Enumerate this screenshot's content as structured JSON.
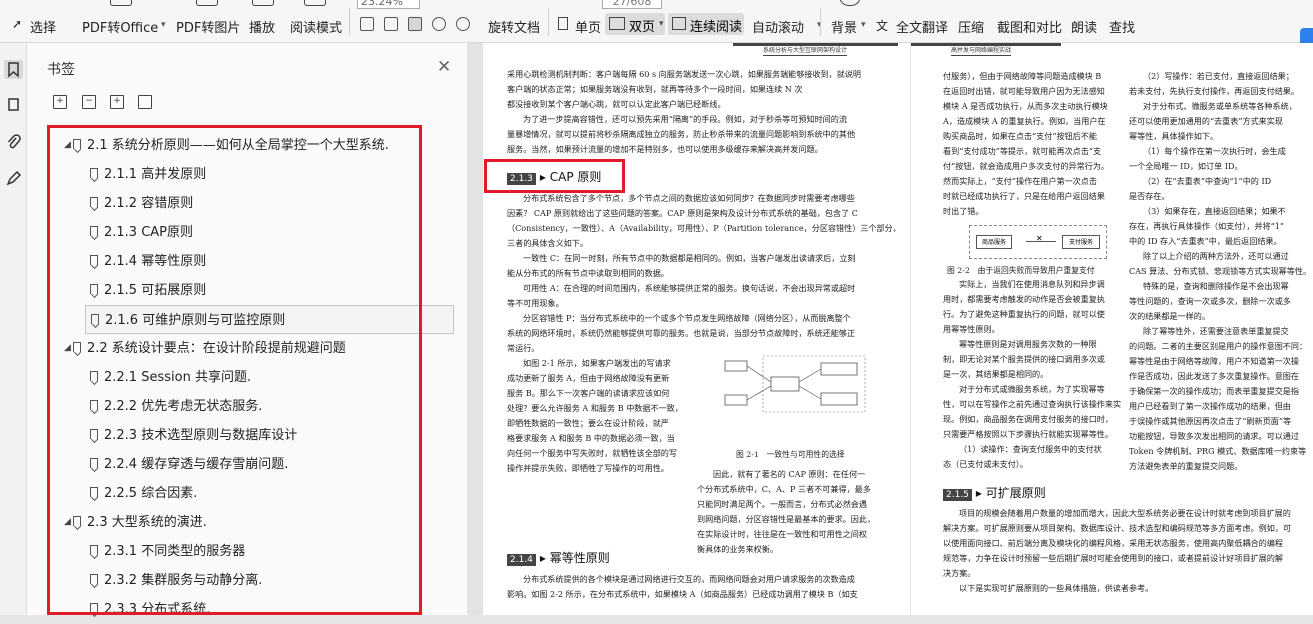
{
  "toolbar": {
    "select": "选择",
    "pdf_office": "PDF转Office",
    "pdf_image": "PDF转图片",
    "play": "播放",
    "read_mode": "阅读模式",
    "zoom": "23.24%",
    "page_indicator": "27/608",
    "rotate": "旋转文档",
    "single": "单页",
    "double": "双页",
    "continuous": "连续阅读",
    "autoscroll": "自动滚动",
    "background": "背景",
    "translate": "全文翻译",
    "compress": "压缩",
    "screenshot": "截图和对比",
    "read_aloud": "朗读",
    "find": "查找"
  },
  "panel": {
    "title": "书签",
    "items": [
      {
        "level": 1,
        "label": "2.1 系统分析原则——如何从全局掌控一个大型系统."
      },
      {
        "level": 2,
        "label": "2.1.1 高并发原则"
      },
      {
        "level": 2,
        "label": "2.1.2 容错原则"
      },
      {
        "level": 2,
        "label": "2.1.3 CAP原则"
      },
      {
        "level": 2,
        "label": "2.1.4 幂等性原则"
      },
      {
        "level": 2,
        "label": "2.1.5 可拓展原则"
      },
      {
        "level": 2,
        "label": "2.1.6 可维护原则与可监控原则"
      },
      {
        "level": 1,
        "label": "2.2 系统设计要点：在设计阶段提前规避问题"
      },
      {
        "level": 2,
        "label": "2.2.1 Session 共享问题."
      },
      {
        "level": 2,
        "label": "2.2.2 优先考虑无状态服务."
      },
      {
        "level": 2,
        "label": "2.2.3 技术选型原则与数据库设计"
      },
      {
        "level": 2,
        "label": "2.2.4 缓存穿透与缓存雪崩问题."
      },
      {
        "level": 2,
        "label": "2.2.5 综合因素."
      },
      {
        "level": 1,
        "label": "2.3 大型系统的演进."
      },
      {
        "level": 2,
        "label": "2.3.1 不同类型的服务器"
      },
      {
        "level": 2,
        "label": "2.3.2 集群服务与动静分离."
      },
      {
        "level": 2,
        "label": "2.3.3 分布式系统."
      }
    ]
  },
  "doc": {
    "left_header": "系统分析与大型互联网架构设计",
    "right_header": "高并发与网络编程实战",
    "sec_213_num": "2.1.3",
    "sec_213_title": "CAP 原则",
    "sec_214_num": "2.1.4",
    "sec_214_title": "幂等性原则",
    "sec_215_num": "2.1.5",
    "sec_215_title": "可扩展原则",
    "fig21_caption": "图 2-1　一致性与可用性的选择",
    "fig22_caption": "图 2-2　由于返回失败而导致用户重复支付",
    "fig22_box1": "商品服务",
    "fig22_box2": "支付服务",
    "p1_lines": [
      "采用心跳检测机制判断：客户端每隔 60 s 向服务端发送一次心跳，如果服务端能够接收到，就说明",
      "客户端的状态正常；如果服务端没有收到，就再等待多个一段时间，如果连续 N 次",
      "都没接收到某个客户端心跳，就可以认定此客户端已经断线。",
      "为了进一步提高容错性，还可以预先采用“隔离”的手段。例如，对于秒杀等可预知时间的流",
      "量暴增情况，就可以提前将秒杀隔离成独立的服务，防止秒杀带来的流量问题影响到系统中的其他",
      "服务。当然，如果预计流量的增加不是特别多，也可以使用多级缓存来解决高并发问题。"
    ],
    "p2_lines": [
      "分布式系统包含了多个节点，多个节点之间的数据应该如何同步？在数据同步时需要考虑哪些",
      "因素？ CAP 原则就给出了这些问题的答案。CAP 原则是架构及设计分布式系统的基础，包含了 C",
      "（Consistency，一致性）、A（Availability，可用性）、P（Partition tolerance，分区容错性）三个部分，",
      "三者的具体含义如下。",
      "一致性 C：在同一时刻，所有节点中的数据都是相同的。例如，当客户端发出读请求后，立刻",
      "能从分布式的所有节点中读取到相同的数据。",
      "可用性 A：在合理的时间范围内，系统能够提供正常的服务。换句话说，不会出现异常或超时",
      "等不可用现象。",
      "分区容错性 P：当分布式系统中的一个或多个节点发生网络故障（网络分区），从而脱离整个",
      "系统的网络环境时，系统仍然能够提供可靠的服务。也就是说，当部分节点故障时，系统还能够正",
      "常运行。"
    ],
    "p3_lines": [
      "如图 2-1 所示，如果客户端发出的写请求",
      "成功更新了服务 A，但由于网络故障没有更新",
      "服务 B。那么下一次客户端的读请求应该如何",
      "处理？要么允许服务 A 和服务 B 中数据不一致，",
      "即牺牲数据的一致性；要么在设计阶段，就严",
      "格要求服务 A 和服务 B 中的数据必须一致，当",
      "向任何一个服务中写失败时，就牺牲该全部的写",
      "操作并提示失败，即牺牲了写操作的可用性。"
    ],
    "p4_lines": [
      "因此，就有了著名的 CAP 原则：在任何一",
      "个分布式系统中，C、A、P 三者不可兼得，最多",
      "只能同时满足两个。一般而言，分布式必然会遇",
      "到网络问题，分区容错性是最基本的要求。因此，",
      "在实际设计时，往往是在一致性和可用性之间权",
      "衡具体的业务来权衡。"
    ],
    "p5_lines": [
      "分布式系统提供的各个模块是通过网络进行交互的，而网络问题会对用户请求服务的次数造成",
      "影响。如图 2-2 所示，在分布式系统中，如果模块 A（如商品服务）已经成功调用了模块 B（如支"
    ],
    "r1_lines": [
      "付服务），但由于网络故障等问题造成模块 B",
      "在返回时出错，就可能导致用户因为无法感知",
      "模块 A 是否成功执行，从而多次主动执行模块",
      "A，造成模块 A 的重复执行。例如，当用户在",
      "购买商品时，如果在点击“支付”按钮后不能",
      "看到“支付成功”等提示，就可能再次点击“支",
      "付”按钮，就会造成用户多次支付的异常行为。",
      "然而实际上，“支付”操作在用户第一次点击",
      "时就已经成功执行了，只是在给用户返回结果",
      "时出了错。"
    ],
    "r2_lines": [
      "（2）写操作：若已支付，直接返回结果；",
      "若未支付，先执行支付操作，再返回支付结果。",
      "对于分布式、微服务或单系统等各种系统，",
      "还可以使用更加通用的“去重表”方式来实现",
      "幂等性，具体操作如下。",
      "（1）每个操作在第一次执行时，会生成",
      "一个全局唯一 ID，如订单 ID。",
      "（2）在“去重表”中查询“1”中的 ID",
      "是否存在。",
      "（3）如果存在，直接返回结果；如果不",
      "存在，再执行具体操作（如支付），并将“1”",
      "中的 ID 存入“去重表”中，最后返回结果。",
      "除了以上介绍的两种方法外，还可以通过",
      "CAS 算法、分布式锁、悲观锁等方式实现幂等性。",
      "特殊的是，查询和删除操作是不会出现幂",
      "等性问题的，查询一次或多次，删除一次或多",
      "次的结果都是一样的。",
      "除了幂等性外，还需要注意表单重复提交",
      "的问题。二者的主要区别是用户的操作意图不同：",
      "幂等性是由于网络等故障，用户不知道第一次操",
      "作是否成功，因此发送了多次重复操作。意图在",
      "于确保第一次的操作成功；而表单重复提交是指",
      "用户已经看到了第一次操作成功的结果，但由",
      "于误操作或其他原因再次点击了“刷新页面”等",
      "功能按钮，导致多次发出相同的请求。可以通过",
      "Token 令牌机制、PRG 模式、数据库唯一约束等",
      "方法避免表单的重复提交问题。"
    ],
    "r3_lines": [
      "实际上，当我们在使用消息队列和异步调",
      "用时，都需要考虑触发的动作是否会被重复执",
      "行。为了避免这种重复执行的问题，就可以使",
      "用幂等性原则。",
      "幂等性原则是对调用服务次数的一种限",
      "制，即无论对某个服务提供的接口调用多次或",
      "是一次，其结果都是相同的。",
      "对于分布式或微服务系统，为了实现幂等",
      "性，可以在写操作之前先通过查询执行该操作来实",
      "现。例如，商品服务在调用支付服务的接口时，",
      "只需要严格按照以下步骤执行就能实现幂等性。",
      "（1）读操作：查询支付服务中的支付状",
      "态（已支付或未支付）。"
    ],
    "r4_lines": [
      "项目的规模会随着用户数量的增加而增大，因此大型系统务必要在设计时就考虑到项目扩展的",
      "解决方案。可扩展原则要从项目架构、数据库设计、技术选型和编码规范等多方面考虑。例如，可",
      "以使用面向接口、前后端分离及模块化的编程风格，采用无状态服务，使用高内聚低耦合的编程",
      "规范等，力争在设计时预留一些后期扩展时可能会使用到的接口，或者提前设计好项目扩展的解",
      "决方案。",
      "以下是实现可扩展原则的一些具体措施，供读者参考。"
    ]
  }
}
